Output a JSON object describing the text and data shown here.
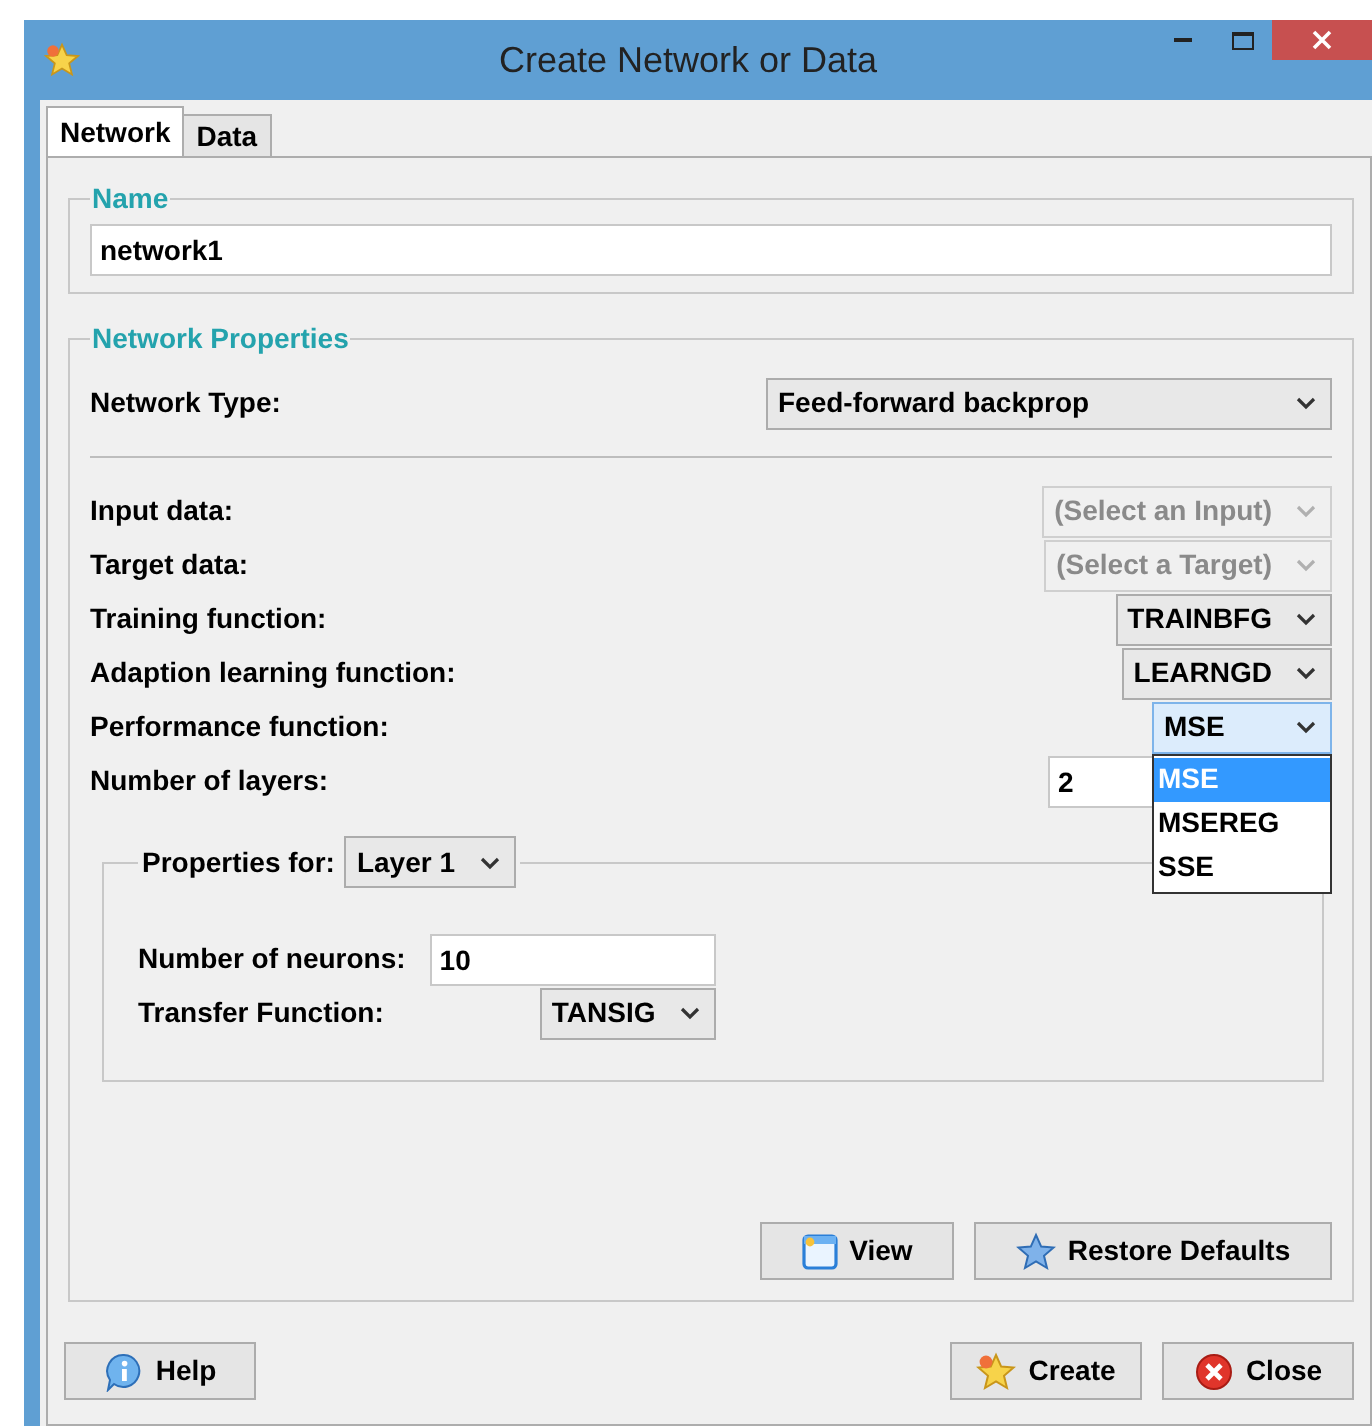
{
  "window": {
    "title": "Create Network or Data"
  },
  "tabs": [
    {
      "label": "Network",
      "selected": true
    },
    {
      "label": "Data",
      "selected": false
    }
  ],
  "name_section": {
    "title": "Name",
    "value": "network1"
  },
  "properties": {
    "title": "Network Properties",
    "network_type": {
      "label": "Network Type:",
      "value": "Feed-forward backprop"
    },
    "fields": [
      {
        "kind": "dropdown",
        "label": "Input data:",
        "value": "(Select an Input)",
        "disabled": true,
        "expanded": false
      },
      {
        "kind": "dropdown",
        "label": "Target data:",
        "value": "(Select a Target)",
        "disabled": true,
        "expanded": false
      },
      {
        "kind": "dropdown",
        "label": "Training function:",
        "value": "TRAINBFG",
        "disabled": false,
        "expanded": false
      },
      {
        "kind": "dropdown",
        "label": "Adaption learning function:",
        "value": "LEARNGD",
        "disabled": false,
        "expanded": false
      },
      {
        "kind": "dropdown",
        "label": "Performance function:",
        "value": "MSE",
        "disabled": false,
        "expanded": true,
        "options": [
          {
            "label": "MSE",
            "selected": true
          },
          {
            "label": "MSEREG",
            "selected": false
          },
          {
            "label": "SSE",
            "selected": false
          }
        ]
      },
      {
        "kind": "text",
        "label": "Number of layers:",
        "value": "2"
      }
    ],
    "layer": {
      "label": "Properties for:",
      "value": "Layer 1",
      "fields": [
        {
          "kind": "text",
          "label": "Number of neurons:",
          "value": "10"
        },
        {
          "kind": "dropdown",
          "label": "Transfer Function:",
          "value": "TANSIG"
        }
      ]
    },
    "buttons": [
      {
        "kind": "view",
        "label": "View"
      },
      {
        "kind": "restore",
        "label": "Restore Defaults"
      }
    ]
  },
  "footer_buttons": [
    {
      "kind": "help",
      "label": "Help"
    },
    {
      "kind": "create",
      "label": "Create"
    },
    {
      "kind": "close",
      "label": "Close"
    }
  ]
}
